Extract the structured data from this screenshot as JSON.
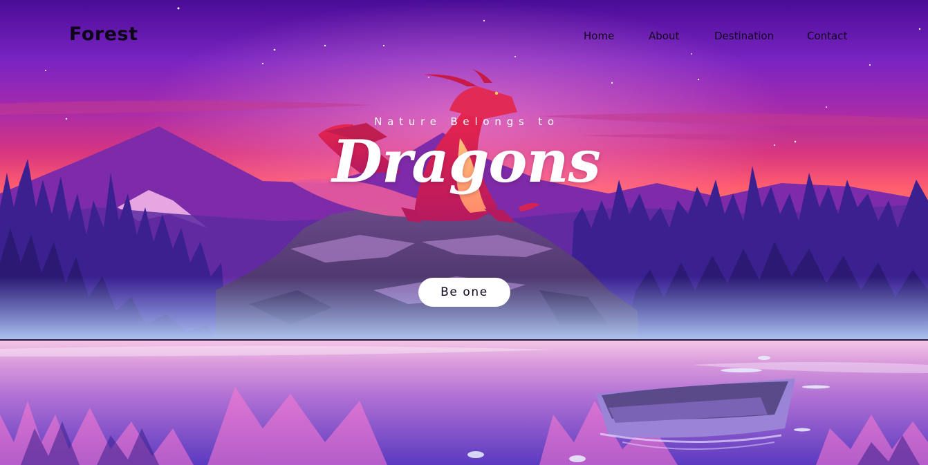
{
  "brand": {
    "name": "Forest"
  },
  "nav": {
    "items": [
      {
        "label": "Home"
      },
      {
        "label": "About"
      },
      {
        "label": "Destination"
      },
      {
        "label": "Contact"
      }
    ]
  },
  "hero": {
    "tagline": "Nature Belongs to",
    "headline": "Dragons",
    "button_label": "Be one"
  },
  "colors": {
    "sky_top": "#4a0f9a",
    "sky_mid": "#8a2bc8",
    "horizon": "#ff5a78",
    "trees": "#3a1f8c",
    "dragon": "#e0245e",
    "water": "#d07bd4",
    "button_bg": "#ffffff"
  }
}
